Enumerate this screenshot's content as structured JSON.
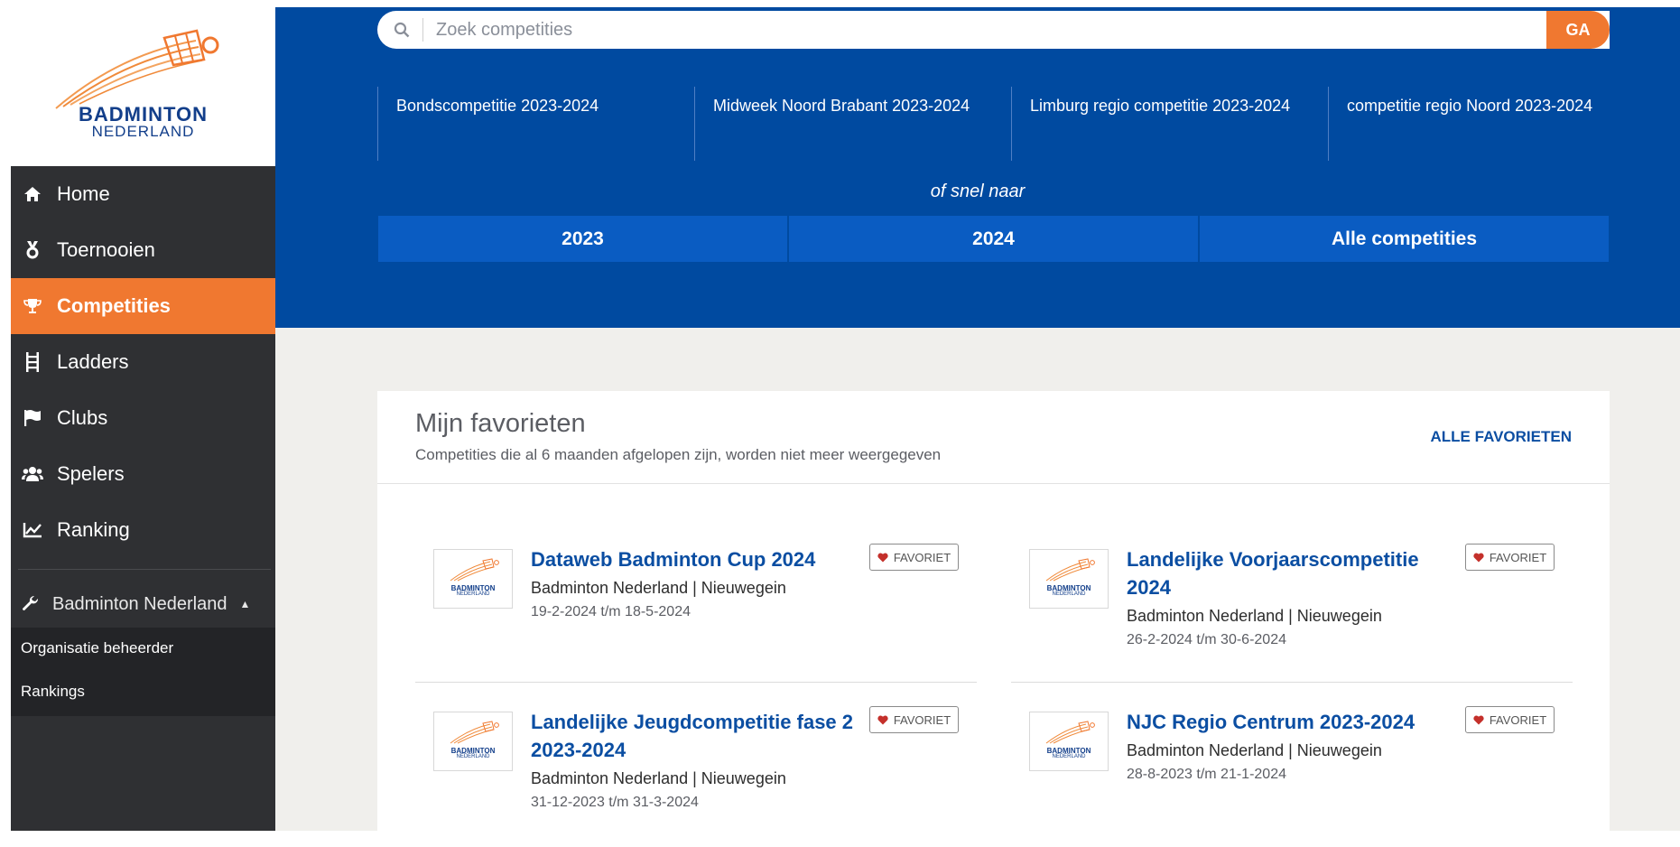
{
  "sidebar": {
    "logo": {
      "line1": "BADMINTON",
      "line2": "NEDERLAND"
    },
    "items": [
      {
        "label": "Home",
        "icon": "home-icon"
      },
      {
        "label": "Toernooien",
        "icon": "medal-icon"
      },
      {
        "label": "Competities",
        "icon": "trophy-icon",
        "active": true
      },
      {
        "label": "Ladders",
        "icon": "ladder-icon"
      },
      {
        "label": "Clubs",
        "icon": "flag-icon"
      },
      {
        "label": "Spelers",
        "icon": "users-icon"
      },
      {
        "label": "Ranking",
        "icon": "chart-line-icon"
      }
    ],
    "section": {
      "label": "Badminton Nederland",
      "icon": "wrench-icon"
    },
    "subitems": [
      {
        "label": "Organisatie beheerder"
      },
      {
        "label": "Rankings"
      }
    ]
  },
  "hero": {
    "search_placeholder": "Zoek competities",
    "search_button": "GA",
    "suggestions": [
      {
        "label": "Bondscompetitie 2023-2024"
      },
      {
        "label": "Midweek Noord Brabant 2023-2024"
      },
      {
        "label": "Limburg regio competitie 2023-2024"
      },
      {
        "label": "competitie regio Noord 2023-2024"
      }
    ],
    "quick_label": "of snel naar",
    "quick_links": [
      {
        "label": "2023"
      },
      {
        "label": "2024"
      },
      {
        "label": "Alle competities"
      }
    ]
  },
  "favorites": {
    "title": "Mijn favorieten",
    "subtitle": "Competities die al 6 maanden afgelopen zijn, worden niet meer weergegeven",
    "all_link": "ALLE FAVORIETEN",
    "fav_label": "FAVORIET",
    "thumb_line1": "BADMINTON",
    "thumb_line2": "NEDERLAND",
    "items": [
      {
        "name": "Dataweb Badminton Cup 2024",
        "org": "Badminton Nederland | Nieuwegein",
        "date": "19-2-2024 t/m 18-5-2024"
      },
      {
        "name": "Landelijke Voorjaarscompetitie 2024",
        "org": "Badminton Nederland | Nieuwegein",
        "date": "26-2-2024 t/m 30-6-2024"
      },
      {
        "name": "Landelijke Jeugdcompetitie fase 2 2023-2024",
        "org": "Badminton Nederland | Nieuwegein",
        "date": "31-12-2023 t/m 31-3-2024"
      },
      {
        "name": "NJC Regio Centrum 2023-2024",
        "org": "Badminton Nederland | Nieuwegein",
        "date": "28-8-2023 t/m 21-1-2024"
      }
    ]
  },
  "colors": {
    "brand_blue": "#004aa0",
    "accent_orange": "#f07830",
    "sidebar_dark": "#2f3033",
    "link_blue": "#0b4ea2"
  }
}
